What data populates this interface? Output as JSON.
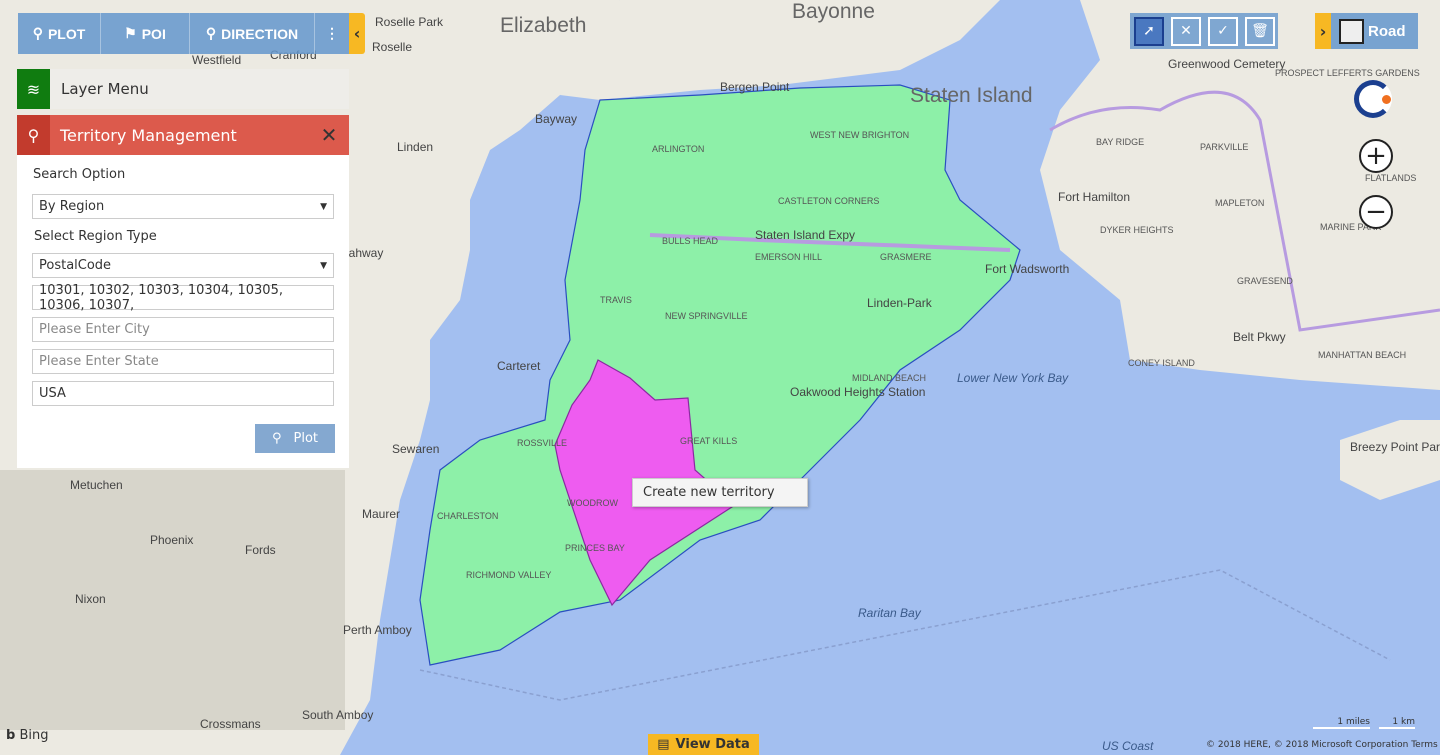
{
  "toolbar": {
    "plot": "PLOT",
    "poi": "POI",
    "direction": "DIRECTION",
    "more": "⋮",
    "collapse": "‹"
  },
  "layer_menu": {
    "label": "Layer Menu"
  },
  "territory": {
    "title": "Territory Management",
    "search_option_label": "Search Option",
    "search_option_value": "By Region",
    "region_type_label": "Select Region Type",
    "region_type_value": "PostalCode",
    "postal_codes": "10301, 10302, 10303, 10304, 10305, 10306, 10307,",
    "city_placeholder": "Please Enter City",
    "state_placeholder": "Please Enter State",
    "country": "USA",
    "plot_button": "Plot"
  },
  "map_tools": [
    "select-pointer-icon",
    "clear-selection-icon",
    "confirm-selection-icon",
    "trash-icon"
  ],
  "map_type": {
    "label": "Road",
    "expand": "›"
  },
  "zoom": {
    "in": "+",
    "out": "−"
  },
  "context_menu": {
    "item": "Create new territory"
  },
  "view_data": {
    "label": "View Data"
  },
  "bing": "Bing",
  "scale": {
    "miles": "1 miles",
    "km": "1 km"
  },
  "copyright": "© 2018 HERE, © 2018 Microsoft Corporation  Terms",
  "colors": {
    "water": "#a3bff0",
    "land": "#eceae2",
    "territory_green": "#8df0a8",
    "territory_selected": "#ee5cf0",
    "accent_yellow": "#f7b823",
    "header_red": "#dc5a4c"
  },
  "map_labels": [
    "Elizabeth",
    "Bayonne",
    "Staten Island",
    "Roselle Park",
    "Roselle",
    "Westfield",
    "Cranford",
    "Linden",
    "Rahway",
    "Carteret",
    "Perth Amboy",
    "South Amboy",
    "Metuchen",
    "Fords",
    "Phoenix",
    "Nixon",
    "Crossmans",
    "Sewaren",
    "Maurer",
    "Bayway",
    "Bergen Point",
    "Fort Hamilton",
    "Fort Wadsworth",
    "Lower New York Bay",
    "Raritan Bay",
    "Breezy Point Park",
    "ARLINGTON",
    "WEST NEW BRIGHTON",
    "CASTLETON CORNERS",
    "BULLS HEAD",
    "EMERSON HILL",
    "GRASMERE",
    "Linden-Park",
    "NEW SPRINGVILLE",
    "TRAVIS",
    "Staten Island Expy",
    "Oakwood Heights Station",
    "MIDLAND BEACH",
    "GREAT KILLS",
    "ROSSVILLE",
    "CHARLESTON",
    "WOODROW",
    "PRINCES BAY",
    "RICHMOND VALLEY",
    "BAY RIDGE",
    "DYKER HEIGHTS",
    "MAPLETON",
    "FLATLANDS",
    "GRAVESEND",
    "MARINE PARK",
    "CONEY ISLAND",
    "MANHATTAN BEACH",
    "Greenwood Cemetery",
    "PROSPECT LEFFERTS GARDENS",
    "PARKVILLE",
    "Belt Pkwy",
    "US Coast"
  ]
}
